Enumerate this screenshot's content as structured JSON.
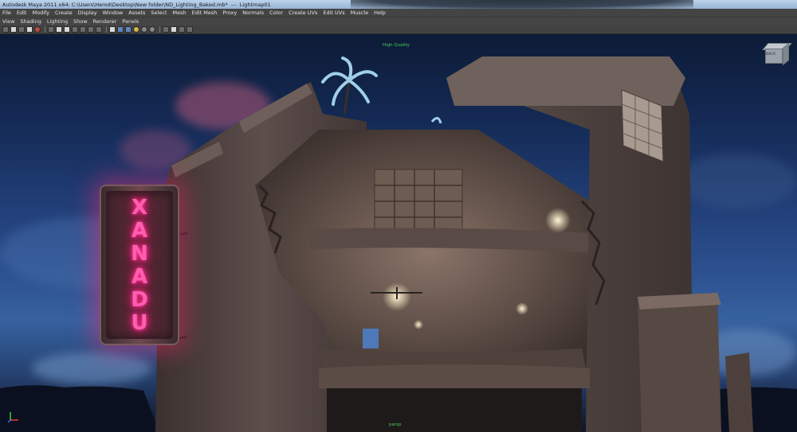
{
  "window": {
    "app_title": "Autodesk Maya 2011 x64: C:\\Users\\Herod\\Desktop\\New folder\\ND_Lighting_Baked.mb*",
    "separator": "---",
    "panel_title": "Lightmap01"
  },
  "menu": [
    "File",
    "Edit",
    "Modify",
    "Create",
    "Display",
    "Window",
    "Assets",
    "Select",
    "Mesh",
    "Edit Mesh",
    "Proxy",
    "Normals",
    "Color",
    "Create UVs",
    "Edit UVs",
    "Muscle",
    "Help"
  ],
  "panel_menu": [
    "View",
    "Shading",
    "Lighting",
    "Show",
    "Renderer",
    "Panels"
  ],
  "toolbar_icons": [
    "camera-select-icon",
    "camera-attributes-icon",
    "bookmark-icon",
    "image-plane-icon",
    "2d-pan-icon",
    "grid-icon",
    "film-gate-icon",
    "resolution-gate-icon",
    "gate-mask-icon",
    "field-chart-icon",
    "safe-action-icon",
    "safe-title-icon",
    "wireframe-icon",
    "smooth-shade-icon",
    "textured-icon",
    "lights-icon",
    "shadows-icon",
    "xray-icon",
    "isolate-select-icon",
    "high-quality-icon",
    "default-material-icon",
    "xray-joints-icon"
  ],
  "viewport": {
    "hud_top": "High Quality",
    "hud_bottom": "persp",
    "sign_letters": [
      "X",
      "A",
      "N",
      "A",
      "D",
      "U"
    ],
    "viewcube_label": "BACK"
  },
  "colors": {
    "neon": "#ff5fb0",
    "hud_green": "#47c85a",
    "title_bar": "#bcd2ea"
  }
}
